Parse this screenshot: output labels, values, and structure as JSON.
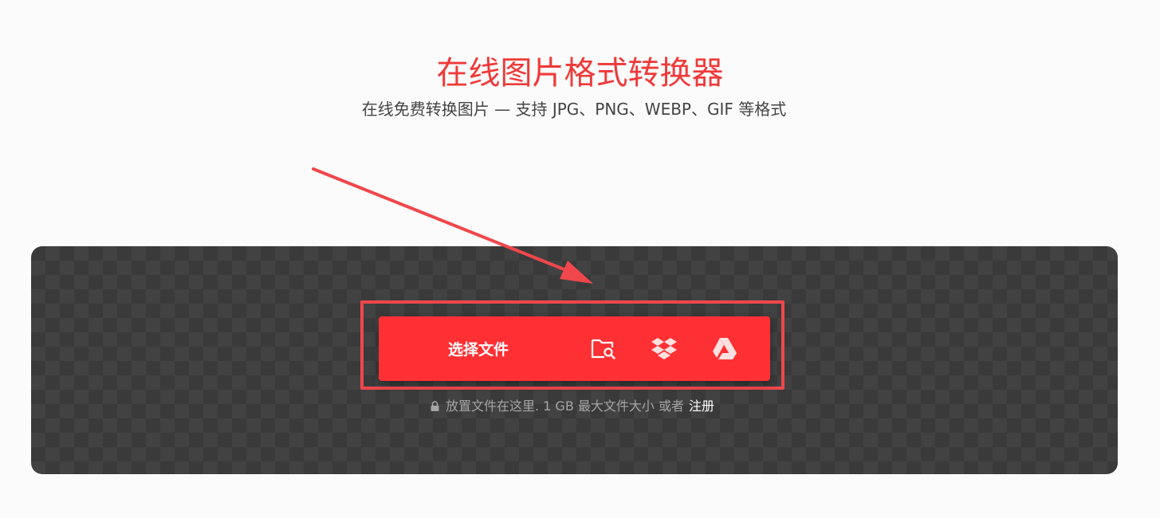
{
  "header": {
    "title": "在线图片格式转换器",
    "subtitle": "在线免费转换图片 — 支持 JPG、PNG、WEBP、GIF 等格式"
  },
  "uploader": {
    "choose_file_label": "选择文件",
    "icons": [
      "folder-search-icon",
      "dropbox-icon",
      "google-drive-icon"
    ],
    "drop_hint": "放置文件在这里. 1 GB 最大文件大小 或者",
    "signup_label": "注册"
  },
  "colors": {
    "accent": "#ff3034",
    "title": "#ef3a3a",
    "annotation": "#f0474c",
    "dropzone_bg": "#3a3a3a"
  }
}
